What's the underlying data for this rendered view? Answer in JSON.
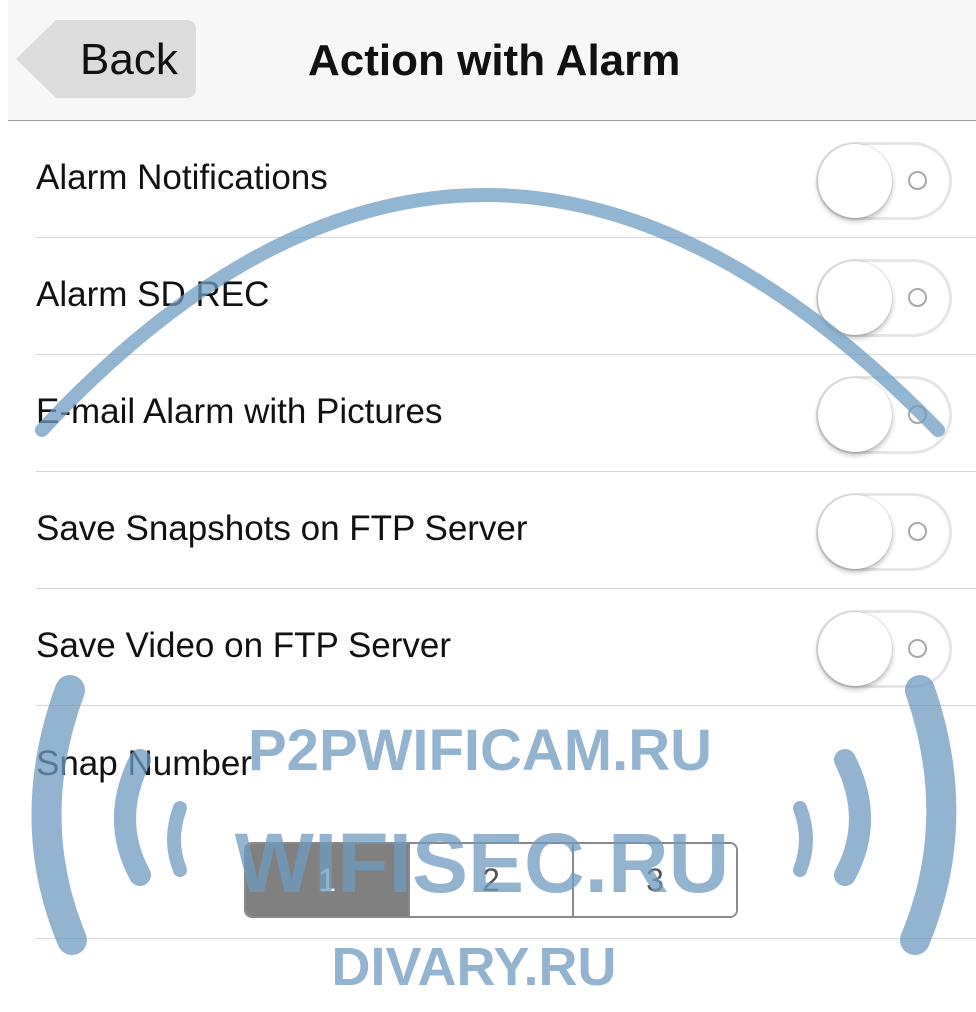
{
  "navbar": {
    "back_label": "Back",
    "title": "Action with Alarm"
  },
  "settings": [
    {
      "label": "Alarm Notifications",
      "enabled": false
    },
    {
      "label": "Alarm SD REC",
      "enabled": false
    },
    {
      "label": "E-mail Alarm with Pictures",
      "enabled": false
    },
    {
      "label": "Save Snapshots on FTP Server",
      "enabled": false
    },
    {
      "label": "Save Video on FTP Server",
      "enabled": false
    }
  ],
  "snap_number": {
    "label": "Snap Number",
    "options": [
      "1",
      "2",
      "3"
    ],
    "selected": "1"
  },
  "watermark": {
    "line1": "P2PWIFICAM.RU",
    "line2": "WIFISEC.RU",
    "line3": "DIVARY.RU"
  },
  "colors": {
    "watermark": "#6e9cc2",
    "segment_selected": "#808080",
    "navbar_bg": "#f7f7f7"
  }
}
